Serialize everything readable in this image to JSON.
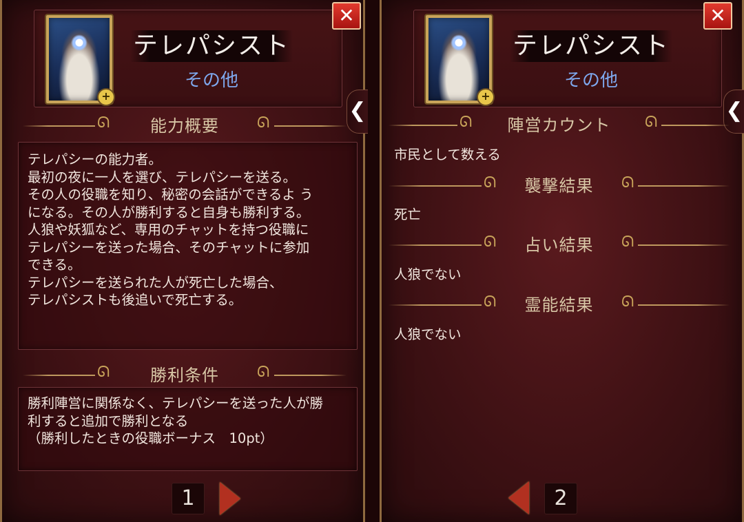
{
  "role": {
    "name": "テレパシスト",
    "faction": "その他"
  },
  "icons": {
    "close": "close-x-icon",
    "zoom": "zoom-plus-icon",
    "side_tab": "chevron-left-icon"
  },
  "left_panel": {
    "ability_heading": "能力概要",
    "ability_text": "テレパシーの能力者。\n最初の夜に一人を選び、テレパシーを送る。\nその人の役職を知り、秘密の会話ができるよ う\nになる。その人が勝利すると自身も勝利する。\n人狼や妖狐など、専用のチャットを持つ役職に\nテレパシーを送った場合、そのチャットに参加\nできる。\nテレパシーを送られた人が死亡した場合、\nテレパシストも後追いで死亡する。",
    "victory_heading": "勝利条件",
    "victory_text": "勝利陣営に関係なく、テレパシーを送った人が勝\n利すると追加で勝利となる\n（勝利したときの役職ボーナス　10pt）",
    "page_number": "1"
  },
  "right_panel": {
    "sections": [
      {
        "heading": "陣営カウント",
        "text": "市民として数える"
      },
      {
        "heading": "襲撃結果",
        "text": "死亡"
      },
      {
        "heading": "占い結果",
        "text": "人狼でない"
      },
      {
        "heading": "霊能結果",
        "text": "人狼でない"
      }
    ],
    "page_number": "2"
  },
  "colors": {
    "panel_bg": "#3f1114",
    "gold": "#c9a45a",
    "heading_text": "#d8c7a6",
    "faction_text": "#7ea8ee",
    "close_red": "#d42a22"
  }
}
